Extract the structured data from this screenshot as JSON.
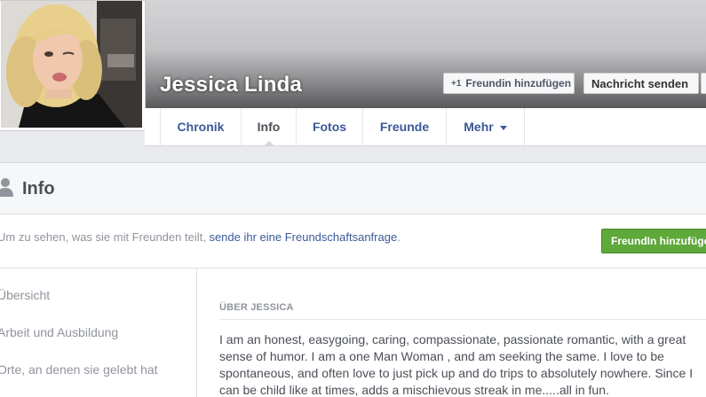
{
  "profile": {
    "name": "Jessica Linda",
    "add_friend_label": "Freundin hinzufügen",
    "add_friend_icon": "+1",
    "message_label": "Nachricht senden"
  },
  "tabs": [
    {
      "label": "Chronik"
    },
    {
      "label": "Info"
    },
    {
      "label": "Fotos"
    },
    {
      "label": "Freunde"
    },
    {
      "label": "Mehr"
    }
  ],
  "info": {
    "title": "Info",
    "friend_prompt_prefix": "Um zu sehen, was sie mit Freunden teilt, ",
    "friend_prompt_link": "sende ihr eine Freundschaftsanfrage",
    "friend_prompt_suffix": ".",
    "friend_button_label": "FreundIn hinzufügen"
  },
  "side_nav": [
    {
      "label": "Übersicht"
    },
    {
      "label": "Arbeit und Ausbildung"
    },
    {
      "label": "Orte, an denen sie gelebt hat"
    }
  ],
  "about": {
    "heading": "ÜBER JESSICA",
    "text": "I am an honest, easygoing, caring, compassionate, passionate romantic, with a great sense of humor. I am a one Man Woman , and am seeking the same. I love to be spontaneous, and often love to just pick up and do trips to absolutely nowhere. Since I can be child like at times, adds a mischievous streak in me.....all in fun."
  },
  "colors": {
    "link_blue": "#3b5998",
    "active_tab": "#4b4f56",
    "green_button": "#5fa83a",
    "page_bg": "#e9eaed"
  }
}
